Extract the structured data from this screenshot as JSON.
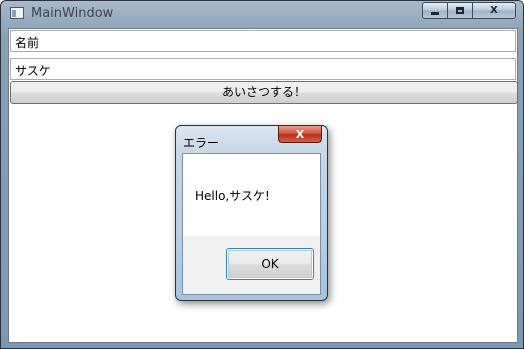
{
  "window": {
    "title": "MainWindow",
    "caption_buttons": {
      "minimize": "minimize-icon",
      "maximize": "maximize-icon",
      "close": "close-icon",
      "close_glyph": "X"
    }
  },
  "form": {
    "name_field_value": "名前",
    "input_field_value": "サスケ",
    "greet_button_label": "あいさつする！"
  },
  "dialog": {
    "title": "エラー",
    "close_glyph": "X",
    "message": "Hello,サスケ!",
    "ok_label": "OK"
  },
  "colors": {
    "frame": "#8aa0b6",
    "close_button": "#d3543f",
    "default_button_border": "#3c7fb1"
  }
}
